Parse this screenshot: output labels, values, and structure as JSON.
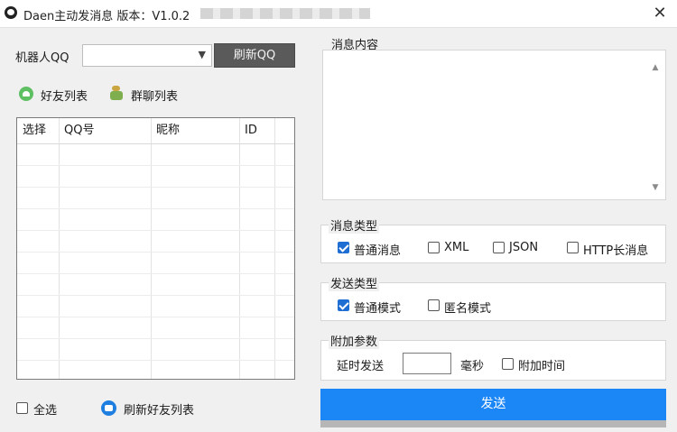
{
  "window": {
    "title": "Daen主动发消息  版本：V1.0.2"
  },
  "bot": {
    "label": "机器人QQ",
    "selected": "",
    "refresh_label": "刷新QQ"
  },
  "lists": {
    "friends_label": "好友列表",
    "groups_label": "群聊列表"
  },
  "table": {
    "columns": [
      "选择",
      "QQ号",
      "昵称",
      "ID"
    ],
    "rows": []
  },
  "footer": {
    "select_all_label": "全选",
    "refresh_friends_label": "刷新好友列表"
  },
  "message": {
    "section_label": "消息内容",
    "value": ""
  },
  "message_type": {
    "section_label": "消息类型",
    "options": [
      {
        "label": "普通消息",
        "checked": true
      },
      {
        "label": "XML",
        "checked": false
      },
      {
        "label": "JSON",
        "checked": false
      },
      {
        "label": "HTTP长消息",
        "checked": false
      }
    ]
  },
  "send_type": {
    "section_label": "发送类型",
    "options": [
      {
        "label": "普通模式",
        "checked": true
      },
      {
        "label": "匿名模式",
        "checked": false
      }
    ]
  },
  "extra": {
    "section_label": "附加参数",
    "delay_label": "延时发送",
    "delay_value": "",
    "unit": "毫秒",
    "append_time_label": "附加时间",
    "append_time_checked": false
  },
  "send_label": "发送",
  "colors": {
    "accent": "#1b86f5",
    "check": "#1f6ed4",
    "dark_button": "#5a5a5a"
  }
}
